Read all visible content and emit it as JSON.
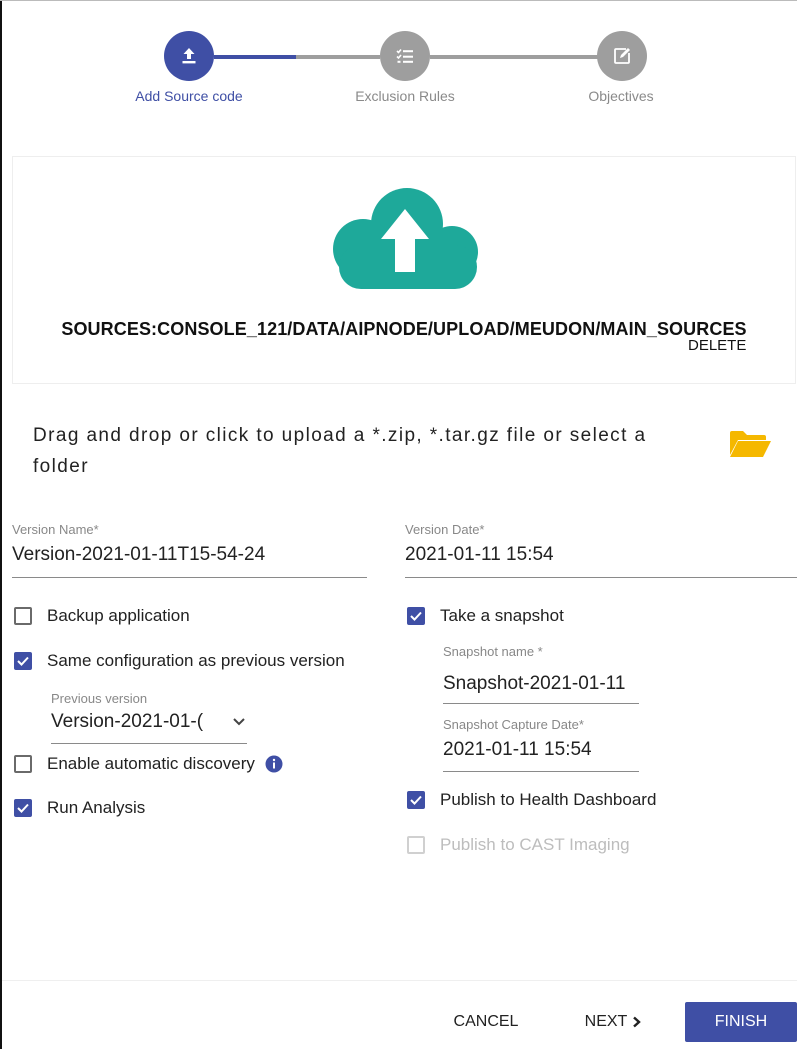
{
  "colors": {
    "accent": "#3f4fa5",
    "inactive_step": "#9e9e9e",
    "upload_cloud": "#1ea99a",
    "folder": "#f5b800"
  },
  "stepper": {
    "steps": [
      {
        "label": "Add Source code",
        "icon": "upload-icon",
        "state": "active"
      },
      {
        "label": "Exclusion Rules",
        "icon": "list-check-icon",
        "state": "inactive"
      },
      {
        "label": "Objectives",
        "icon": "edit-icon",
        "state": "inactive"
      }
    ]
  },
  "upload": {
    "icon": "cloud-upload-icon",
    "source_path": "SOURCES:CONSOLE_121/DATA/AIPNODE/UPLOAD/MEUDON/MAIN_SOURCES",
    "delete_label": "DELETE",
    "drop_text": "Drag and drop or click to upload a *.zip, *.tar.gz file or select a folder",
    "folder_icon": "folder-open-icon"
  },
  "form": {
    "version_name": {
      "label": "Version Name*",
      "value": "Version-2021-01-11T15-54-24"
    },
    "version_date": {
      "label": "Version Date*",
      "value": "2021-01-11 15:54"
    },
    "backup": {
      "label": "Backup application",
      "checked": false
    },
    "same_config": {
      "label": "Same configuration as previous version",
      "checked": true
    },
    "previous_version": {
      "label": "Previous version",
      "value": "Version-2021-01-("
    },
    "auto_discovery": {
      "label": "Enable automatic discovery",
      "checked": false
    },
    "run_analysis": {
      "label": "Run Analysis",
      "checked": true
    },
    "take_snapshot": {
      "label": "Take a snapshot",
      "checked": true
    },
    "snapshot_name": {
      "label": "Snapshot name *",
      "value": "Snapshot-2021-01-11"
    },
    "snapshot_date": {
      "label": "Snapshot Capture Date*",
      "value": "2021-01-11 15:54"
    },
    "publish_health": {
      "label": "Publish to Health Dashboard",
      "checked": true
    },
    "publish_imaging": {
      "label": "Publish to CAST Imaging",
      "checked": false,
      "disabled": true
    }
  },
  "footer": {
    "cancel_label": "CANCEL",
    "next_label": "NEXT",
    "finish_label": "FINISH"
  }
}
